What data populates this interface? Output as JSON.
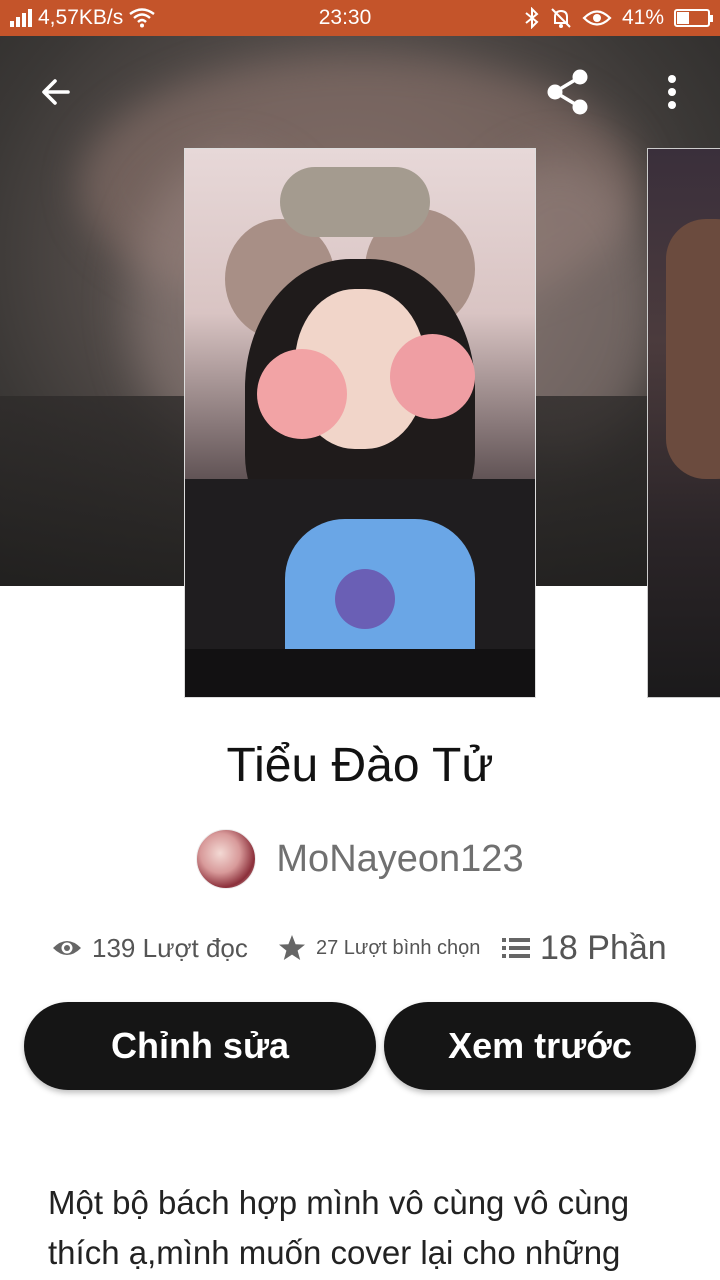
{
  "status_bar": {
    "network_speed": "4,57KB/s",
    "time": "23:30",
    "battery_percent": "41%",
    "battery_level": 0.41,
    "icons": [
      "signal-icon",
      "wifi-icon",
      "bluetooth-icon",
      "mute-bell-icon",
      "eye-comfort-icon",
      "battery-icon"
    ]
  },
  "toolbar": {
    "back_icon": "arrow-left-icon",
    "share_icon": "share-icon",
    "more_icon": "more-vertical-icon"
  },
  "story": {
    "title": "Tiểu Đào Tử",
    "author": "MoNayeon123",
    "stats": {
      "reads": "139 Lượt đọc",
      "votes": "27 Lượt bình chọn",
      "parts": "18 Phần"
    },
    "edit_label": "Chỉnh sửa",
    "preview_label": "Xem trước",
    "description": "Một bộ bách hợp mình vô cùng vô cùng thích ạ,mình muốn cover lại cho những"
  },
  "colors": {
    "status_bar": "#c4542a",
    "button_bg": "#151515",
    "button_text": "#ffffff"
  }
}
